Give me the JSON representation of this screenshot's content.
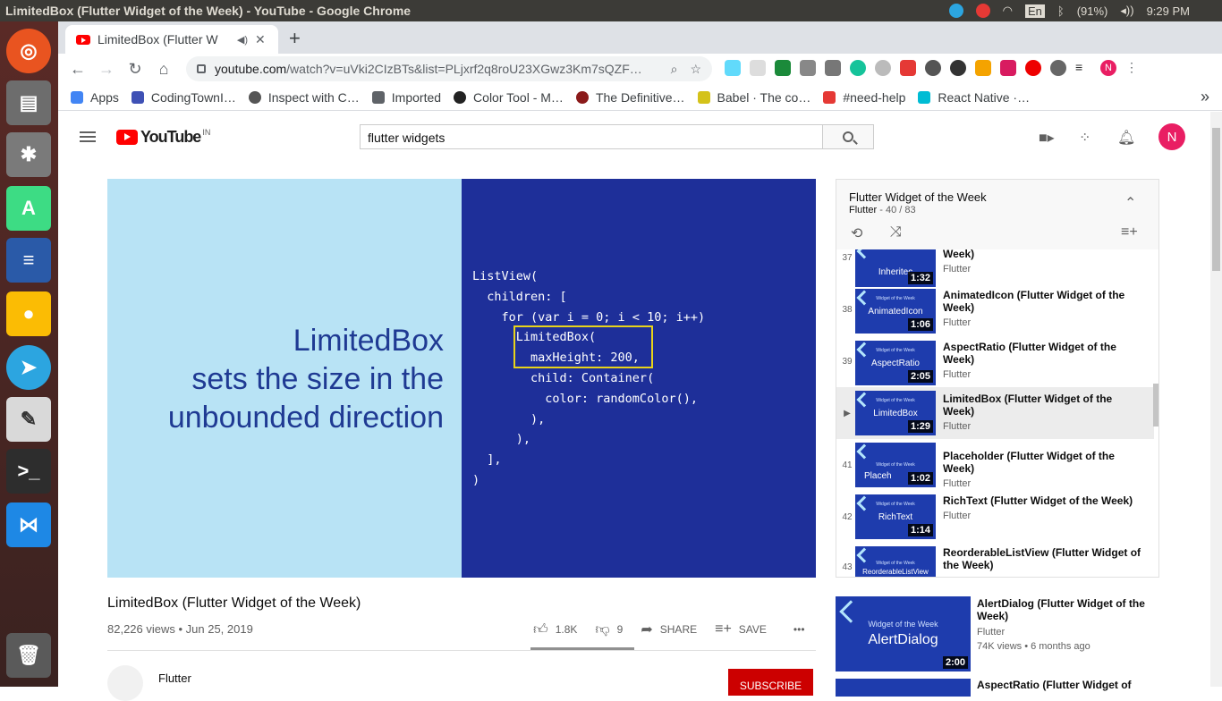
{
  "os": {
    "window_title": "LimitedBox (Flutter Widget of the Week) - YouTube - Google Chrome",
    "keyboard": "En",
    "battery": "(91%)",
    "time": "9:29 PM"
  },
  "launcher": {
    "apps": [
      "ubuntu-icon",
      "files-icon",
      "settings-icon",
      "android-studio-icon",
      "writer-icon",
      "chrome-icon",
      "telegram-icon",
      "text-editor-icon",
      "terminal-icon",
      "vscode-icon",
      "trash-icon"
    ]
  },
  "browser": {
    "tab_title": "LimitedBox (Flutter W",
    "url_host": "youtube.com",
    "url_path": "/watch?v=uVki2CIzBTs&list=PLjxrf2q8roU23XGwz3Km7sQZF…",
    "bookmarks": [
      {
        "label": "Apps",
        "color": "#4285f4"
      },
      {
        "label": "CodingTownI…",
        "color": "#3f51b5"
      },
      {
        "label": "Inspect with C…",
        "color": "#555555"
      },
      {
        "label": "Imported",
        "color": "#5f6368"
      },
      {
        "label": "Color Tool - M…",
        "color": "#222222"
      },
      {
        "label": "The Definitive…",
        "color": "#8b1a1a"
      },
      {
        "label": "Babel · The co…",
        "color": "#d4c21a"
      },
      {
        "label": "#need-help",
        "color": "#e53935"
      },
      {
        "label": "React Native ·…",
        "color": "#00bcd4"
      }
    ],
    "more_bookmarks": "»"
  },
  "youtube": {
    "logo_text": "YouTube",
    "region": "IN",
    "search_value": "flutter widgets",
    "avatar_letter": "N",
    "video": {
      "headline": "LimitedBox",
      "subline1": "sets the size in the",
      "subline2": "unbounded direction",
      "code": "ListView(\n  children: [\n    for (var i = 0; i < 10; i++)\n      LimitedBox(\n        maxHeight: 200,\n        child: Container(\n          color: randomColor(),\n        ),\n      ),\n  ],\n)"
    },
    "title": "LimitedBox (Flutter Widget of the Week)",
    "meta": "82,226 views • Jun 25, 2019",
    "likes": "1.8K",
    "dislikes": "9",
    "share": "SHARE",
    "save": "SAVE",
    "more": "•••",
    "channel": "Flutter",
    "subscribe": "SUBSCRIBE",
    "playlist": {
      "title": "Flutter Widget of the Week",
      "channel": "Flutter",
      "position": "- 40 / 83",
      "items": [
        {
          "idx": "37",
          "label": "Inheritec",
          "title": "Week)",
          "channel": "Flutter",
          "duration": "1:32"
        },
        {
          "idx": "38",
          "label": "AnimatedIcon",
          "title": "AnimatedIcon (Flutter Widget of the Week)",
          "channel": "Flutter",
          "duration": "1:06"
        },
        {
          "idx": "39",
          "label": "AspectRatio",
          "title": "AspectRatio (Flutter Widget of the Week)",
          "channel": "Flutter",
          "duration": "2:05"
        },
        {
          "idx": "▶",
          "label": "LimitedBox",
          "title": "LimitedBox (Flutter Widget of the Week)",
          "channel": "Flutter",
          "duration": "1:29"
        },
        {
          "idx": "41",
          "label": "Placeh",
          "title": "Placeholder (Flutter Widget of the Week)",
          "channel": "Flutter",
          "duration": "1:02"
        },
        {
          "idx": "42",
          "label": "RichText",
          "title": "RichText (Flutter Widget of the Week)",
          "channel": "Flutter",
          "duration": "1:14"
        },
        {
          "idx": "43",
          "label": "ReorderableListView",
          "title": "ReorderableListView (Flutter Widget of the Week)",
          "channel": "Flutter",
          "duration": ""
        }
      ]
    },
    "thumb_caption": "Widget of the Week",
    "up_next": [
      {
        "label": "AlertDialog",
        "title": "AlertDialog (Flutter Widget of the Week)",
        "channel": "Flutter",
        "meta": "74K views • 6 months ago",
        "duration": "2:00"
      },
      {
        "title": "AspectRatio (Flutter Widget of"
      }
    ]
  }
}
